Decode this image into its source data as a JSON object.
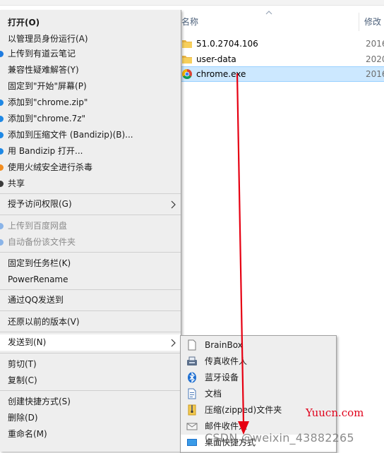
{
  "explorer": {
    "column_headers": {
      "name": "名称",
      "modified": "修改"
    },
    "files": [
      {
        "name": "51.0.2704.106",
        "date": "2016",
        "type": "folder"
      },
      {
        "name": "user-data",
        "date": "2020",
        "type": "folder"
      },
      {
        "name": "chrome.exe",
        "date": "2016",
        "type": "app",
        "selected": true
      }
    ]
  },
  "context_menu": {
    "items": {
      "open": "打开(O)",
      "run_as_admin": "以管理员身份运行(A)",
      "upload_youdao": "上传到有道云笔记",
      "compat_troubleshoot": "兼容性疑难解答(Y)",
      "pin_start": "固定到\"开始\"屏幕(P)",
      "add_zip": "添加到\"chrome.zip\"",
      "add_7z": "添加到\"chrome.7z\"",
      "add_archive": "添加到压缩文件 (Bandizip)(B)...",
      "open_bandizip": "用 Bandizip 打开...",
      "huorong_scan": "使用火绒安全进行杀毒",
      "share": "共享",
      "grant_access": "授予访问权限(G)",
      "upload_baidu": "上传到百度网盘",
      "auto_backup": "自动备份该文件夹",
      "pin_taskbar": "固定到任务栏(K)",
      "powerrename": "PowerRename",
      "send_qq": "通过QQ发送到",
      "restore_prev": "还原以前的版本(V)",
      "send_to": "发送到(N)",
      "cut": "剪切(T)",
      "copy": "复制(C)",
      "create_shortcut": "创建快捷方式(S)",
      "delete": "删除(D)",
      "rename": "重命名(M)"
    }
  },
  "send_to_menu": {
    "items": {
      "brainbox": "BrainBox",
      "fax": "传真收件人",
      "bluetooth": "蓝牙设备",
      "documents": "文档",
      "zip_folder": "压缩(zipped)文件夹",
      "mail": "邮件收件人",
      "desktop_shortcut": "桌面快捷方式"
    }
  },
  "watermarks": {
    "site": "Yuucn.com",
    "csdn": "CSDN @weixin_43882265"
  },
  "colors": {
    "menu_bg": "#eeeeee",
    "selection": "#cce8ff",
    "annotation_arrow": "#e60012"
  }
}
